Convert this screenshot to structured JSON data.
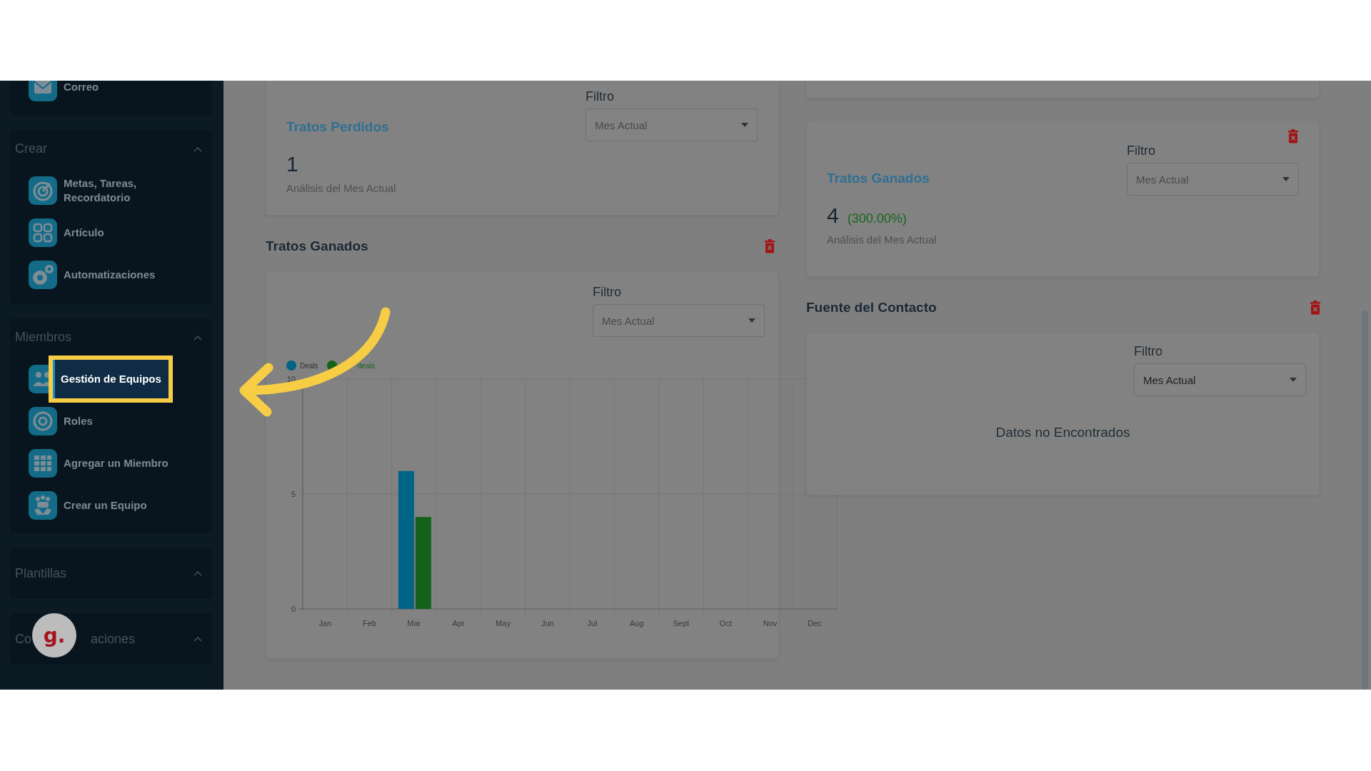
{
  "sidebar": {
    "sections": [
      {
        "items": [
          {
            "label": "Correo",
            "selected": false
          }
        ]
      },
      {
        "title": "Crear",
        "items": [
          {
            "label": "Metas, Tareas,\nRecordatorio",
            "selected": false
          },
          {
            "label": "Artículo",
            "selected": false
          },
          {
            "label": "Automatizaciones",
            "selected": false
          }
        ]
      },
      {
        "title": "Miembros",
        "items": [
          {
            "label": "Gestión de Equipos",
            "selected": true
          },
          {
            "label": "Roles",
            "selected": false
          },
          {
            "label": "Agregar un Miembro",
            "selected": false
          },
          {
            "label": "Crear un Equipo",
            "selected": false
          }
        ]
      },
      {
        "title": "Plantillas"
      },
      {
        "title_parts": [
          "Co",
          "aciones"
        ]
      }
    ]
  },
  "avatar": {
    "letter": "g."
  },
  "lost_card": {
    "title": "Tratos Perdidos",
    "filter_label": "Filtro",
    "filter_value": "Mes Actual",
    "value": "1",
    "caption": "Análisis del Mes Actual"
  },
  "won_chart": {
    "title": "Tratos Ganados",
    "filter_label": "Filtro",
    "filter_value": "Mes Actual",
    "chart_data": {
      "type": "bar",
      "categories": [
        "Jan",
        "Feb",
        "Mar",
        "Apr",
        "May",
        "Jun",
        "Jul",
        "Aug",
        "Sept",
        "Oct",
        "Nov",
        "Dec"
      ],
      "series": [
        {
          "name": "Deals",
          "color": "#006486",
          "values": [
            0,
            0,
            6,
            0,
            0,
            0,
            0,
            0,
            0,
            0,
            0,
            0
          ]
        },
        {
          "name": "deals",
          "color": "#14621a",
          "values": [
            0,
            0,
            4,
            0,
            0,
            0,
            0,
            0,
            0,
            0,
            0,
            0
          ]
        }
      ],
      "legend": true,
      "ylim": [
        0,
        10
      ],
      "yticks": [
        0,
        5,
        10
      ]
    }
  },
  "won_card": {
    "title": "Tratos Ganados",
    "filter_label": "Filtro",
    "filter_value": "Mes Actual",
    "value": "4",
    "change": "(300.00%)",
    "caption": "Análisis del Mes Actual"
  },
  "source": {
    "title": "Fuente del Contacto",
    "filter_label": "Filtro",
    "filter_value": "Mes Actual",
    "empty": "Datos no Encontrados"
  }
}
